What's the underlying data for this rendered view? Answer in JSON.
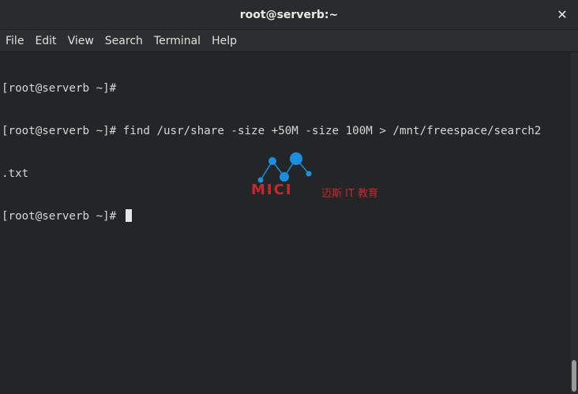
{
  "window": {
    "title": "root@serverb:~",
    "close_symbol": "✕"
  },
  "menu": [
    "File",
    "Edit",
    "View",
    "Search",
    "Terminal",
    "Help"
  ],
  "terminal": {
    "lines": [
      "[root@serverb ~]#",
      "[root@serverb ~]# find /usr/share -size +50M -size 100M > /mnt/freespace/search2",
      ".txt",
      "[root@serverb ~]# "
    ]
  },
  "watermark": {
    "brand": "MICI",
    "tagline": "迈斯 IT 教育",
    "color": "#c9272d",
    "accent": "#1a8fe0"
  },
  "colors": {
    "terminal_bg": "#232627",
    "text": "#d6d6d6"
  }
}
